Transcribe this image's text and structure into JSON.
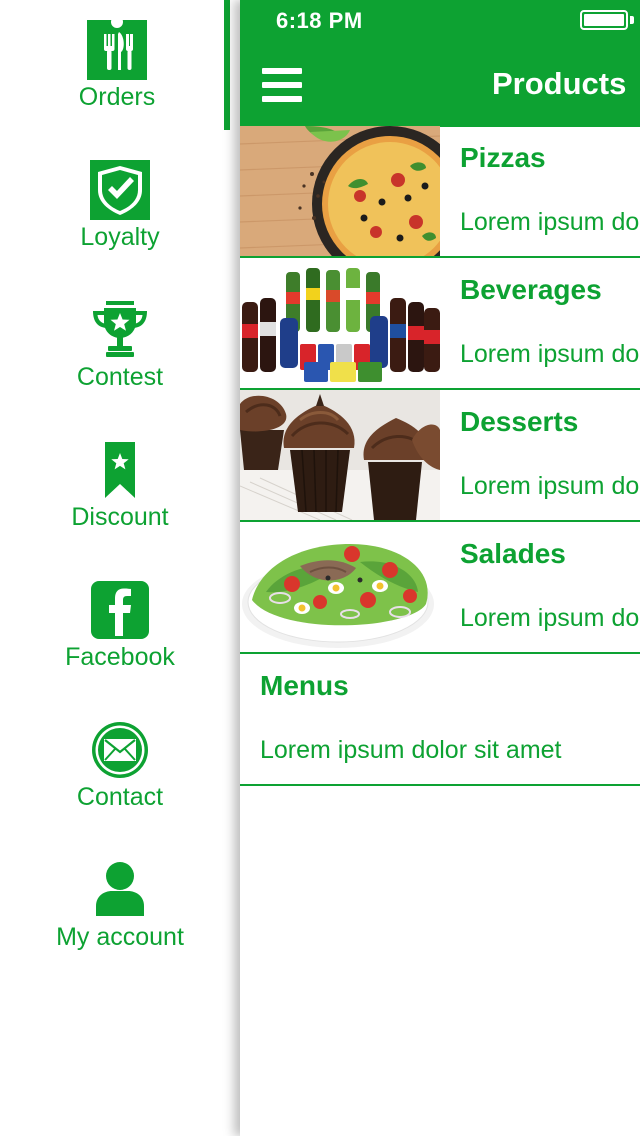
{
  "side_menu": {
    "items": [
      {
        "label": "Orders",
        "icon": "fork-knife-icon"
      },
      {
        "label": "Loyalty",
        "icon": "shield-check-icon"
      },
      {
        "label": "Contest",
        "icon": "trophy-icon"
      },
      {
        "label": "Discount",
        "icon": "ribbon-star-icon"
      },
      {
        "label": "Facebook",
        "icon": "facebook-icon"
      },
      {
        "label": "Contact",
        "icon": "envelope-icon"
      },
      {
        "label": "My account",
        "icon": "user-icon"
      }
    ]
  },
  "status_bar": {
    "time": "6:18 PM"
  },
  "header": {
    "title": "Products"
  },
  "products": [
    {
      "name": "Pizzas",
      "description": "Lorem ipsum dolor sit amet",
      "image": "pizza-image"
    },
    {
      "name": "Beverages",
      "description": "Lorem ipsum dolor sit amet",
      "image": "beverages-image"
    },
    {
      "name": "Desserts",
      "description": "Lorem ipsum dolor sit amet",
      "image": "cupcakes-image"
    },
    {
      "name": "Salades",
      "description": "Lorem ipsum dolor sit amet",
      "image": "salad-image"
    },
    {
      "name": "Menus",
      "description": "Lorem ipsum dolor sit amet"
    }
  ],
  "colors": {
    "brand_green": "#0da232",
    "background": "#ffffff"
  }
}
